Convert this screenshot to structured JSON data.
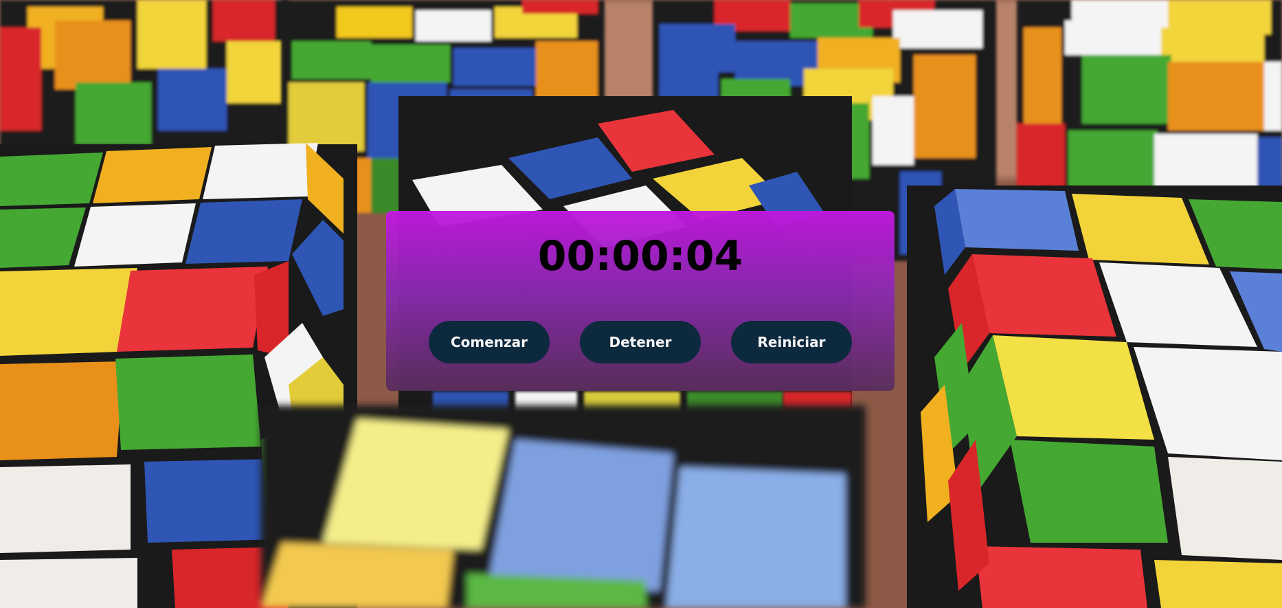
{
  "stopwatch": {
    "time": "00:00:04"
  },
  "controls": {
    "start_label": "Comenzar",
    "stop_label": "Detener",
    "reset_label": "Reiniciar"
  },
  "colors": {
    "panel_top": "#c218e0",
    "panel_bottom": "#5a2e5c",
    "button_bg": "#0d2a40",
    "button_text": "#ffffff",
    "time_text": "#000000"
  },
  "background": {
    "description_icon": "rubiks-cubes-photo"
  }
}
